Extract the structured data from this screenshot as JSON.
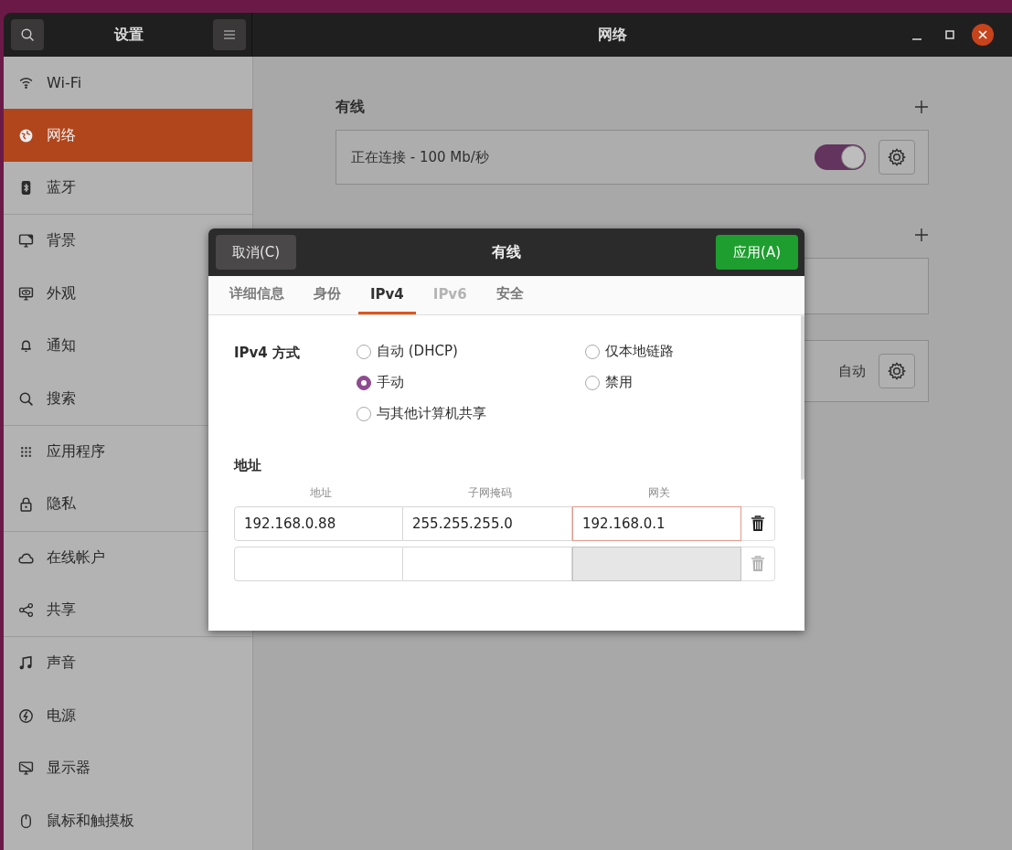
{
  "header": {
    "sidebar_title": "设置",
    "title": "网络"
  },
  "sidebar": {
    "groups": [
      [
        {
          "label": "Wi-Fi",
          "selected": false
        },
        {
          "label": "网络",
          "selected": true
        },
        {
          "label": "蓝牙",
          "selected": false
        }
      ],
      [
        {
          "label": "背景",
          "selected": false
        },
        {
          "label": "外观",
          "selected": false
        },
        {
          "label": "通知",
          "selected": false
        },
        {
          "label": "搜索",
          "selected": false
        }
      ],
      [
        {
          "label": "应用程序",
          "selected": false
        },
        {
          "label": "隐私",
          "selected": false
        }
      ],
      [
        {
          "label": "在线帐户",
          "selected": false
        },
        {
          "label": "共享",
          "selected": false
        }
      ],
      [
        {
          "label": "声音",
          "selected": false
        },
        {
          "label": "电源",
          "selected": false
        },
        {
          "label": "显示器",
          "selected": false
        },
        {
          "label": "鼠标和触摸板",
          "selected": false
        }
      ]
    ]
  },
  "wired": {
    "heading": "有线",
    "connection": {
      "status": "正在连接 - 100 Mb/秒",
      "on": true
    }
  },
  "proxy": {
    "value": "自动"
  },
  "dialog": {
    "cancel": "取消(C)",
    "title": "有线",
    "apply": "应用(A)",
    "tabs": [
      {
        "label": "详细信息",
        "selected": false,
        "disabled": false
      },
      {
        "label": "身份",
        "selected": false,
        "disabled": false
      },
      {
        "label": "IPv4",
        "selected": true,
        "disabled": false
      },
      {
        "label": "IPv6",
        "selected": false,
        "disabled": true
      },
      {
        "label": "安全",
        "selected": false,
        "disabled": false
      }
    ],
    "method": {
      "label": "IPv4 方式",
      "options": [
        {
          "label": "自动 (DHCP)",
          "selected": false
        },
        {
          "label": "仅本地链路",
          "selected": false
        },
        {
          "label": "手动",
          "selected": true
        },
        {
          "label": "禁用",
          "selected": false
        },
        {
          "label": "与其他计算机共享",
          "selected": false
        }
      ]
    },
    "addresses": {
      "heading": "地址",
      "columns": [
        "地址",
        "子网掩码",
        "网关"
      ],
      "rows": [
        {
          "cells": [
            {
              "value": "192.168.0.88",
              "focused": false,
              "disabled": false
            },
            {
              "value": "255.255.255.0",
              "focused": false,
              "disabled": false
            },
            {
              "value": "192.168.0.1",
              "focused": true,
              "disabled": false
            }
          ],
          "removable": true
        },
        {
          "cells": [
            {
              "focused": false,
              "disabled": false
            },
            {
              "focused": false,
              "disabled": false
            },
            {
              "focused": false,
              "disabled": true
            }
          ],
          "removable": false
        }
      ]
    }
  }
}
